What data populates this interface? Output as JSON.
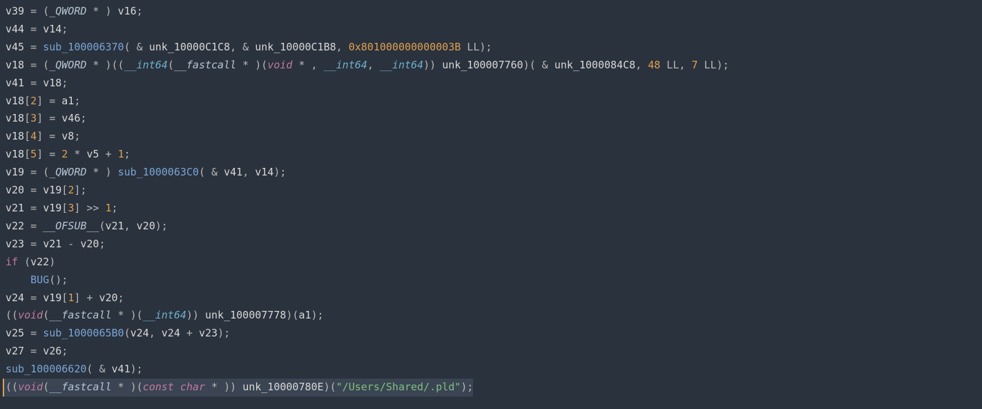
{
  "code": {
    "lines": [
      {
        "tokens": [
          {
            "t": "v39",
            "c": "tk-var"
          },
          {
            "t": " = (",
            "c": "tk-op"
          },
          {
            "t": "_QWORD",
            "c": "tk-type"
          },
          {
            "t": " * ) ",
            "c": "tk-op"
          },
          {
            "t": "v16",
            "c": "tk-var"
          },
          {
            "t": ";",
            "c": "tk-op"
          }
        ]
      },
      {
        "tokens": [
          {
            "t": "v44",
            "c": "tk-var"
          },
          {
            "t": " = ",
            "c": "tk-op"
          },
          {
            "t": "v14",
            "c": "tk-var"
          },
          {
            "t": ";",
            "c": "tk-op"
          }
        ]
      },
      {
        "tokens": [
          {
            "t": "v45",
            "c": "tk-var"
          },
          {
            "t": " = ",
            "c": "tk-op"
          },
          {
            "t": "sub_100006370",
            "c": "tk-sub"
          },
          {
            "t": "( & ",
            "c": "tk-op"
          },
          {
            "t": "unk_10000C1C8",
            "c": "tk-unk"
          },
          {
            "t": ", & ",
            "c": "tk-op"
          },
          {
            "t": "unk_10000C1B8",
            "c": "tk-unk"
          },
          {
            "t": ", ",
            "c": "tk-op"
          },
          {
            "t": "0x801000000000003B",
            "c": "tk-hex"
          },
          {
            "t": " LL);",
            "c": "tk-op"
          }
        ]
      },
      {
        "tokens": [
          {
            "t": "v18",
            "c": "tk-var"
          },
          {
            "t": " = (",
            "c": "tk-op"
          },
          {
            "t": "_QWORD",
            "c": "tk-type"
          },
          {
            "t": " * )((",
            "c": "tk-op"
          },
          {
            "t": "__int64",
            "c": "tk-int64"
          },
          {
            "t": "(",
            "c": "tk-op"
          },
          {
            "t": "__fastcall",
            "c": "tk-type"
          },
          {
            "t": " * )(",
            "c": "tk-op"
          },
          {
            "t": "void",
            "c": "tk-void"
          },
          {
            "t": " * , ",
            "c": "tk-op"
          },
          {
            "t": "__int64",
            "c": "tk-int64"
          },
          {
            "t": ", ",
            "c": "tk-op"
          },
          {
            "t": "__int64",
            "c": "tk-int64"
          },
          {
            "t": ")) ",
            "c": "tk-op"
          },
          {
            "t": "unk_100007760",
            "c": "tk-unk"
          },
          {
            "t": ")( & ",
            "c": "tk-op"
          },
          {
            "t": "unk_1000084C8",
            "c": "tk-unk"
          },
          {
            "t": ", ",
            "c": "tk-op"
          },
          {
            "t": "48",
            "c": "tk-num"
          },
          {
            "t": " LL, ",
            "c": "tk-op"
          },
          {
            "t": "7",
            "c": "tk-num"
          },
          {
            "t": " LL);",
            "c": "tk-op"
          }
        ]
      },
      {
        "tokens": [
          {
            "t": "v41",
            "c": "tk-var"
          },
          {
            "t": " = ",
            "c": "tk-op"
          },
          {
            "t": "v18",
            "c": "tk-var"
          },
          {
            "t": ";",
            "c": "tk-op"
          }
        ]
      },
      {
        "tokens": [
          {
            "t": "v18",
            "c": "tk-var"
          },
          {
            "t": "[",
            "c": "tk-op"
          },
          {
            "t": "2",
            "c": "tk-num"
          },
          {
            "t": "] = ",
            "c": "tk-op"
          },
          {
            "t": "a1",
            "c": "tk-var"
          },
          {
            "t": ";",
            "c": "tk-op"
          }
        ]
      },
      {
        "tokens": [
          {
            "t": "v18",
            "c": "tk-var"
          },
          {
            "t": "[",
            "c": "tk-op"
          },
          {
            "t": "3",
            "c": "tk-num"
          },
          {
            "t": "] = ",
            "c": "tk-op"
          },
          {
            "t": "v46",
            "c": "tk-var"
          },
          {
            "t": ";",
            "c": "tk-op"
          }
        ]
      },
      {
        "tokens": [
          {
            "t": "v18",
            "c": "tk-var"
          },
          {
            "t": "[",
            "c": "tk-op"
          },
          {
            "t": "4",
            "c": "tk-num"
          },
          {
            "t": "] = ",
            "c": "tk-op"
          },
          {
            "t": "v8",
            "c": "tk-var"
          },
          {
            "t": ";",
            "c": "tk-op"
          }
        ]
      },
      {
        "tokens": [
          {
            "t": "v18",
            "c": "tk-var"
          },
          {
            "t": "[",
            "c": "tk-op"
          },
          {
            "t": "5",
            "c": "tk-num"
          },
          {
            "t": "] = ",
            "c": "tk-op"
          },
          {
            "t": "2",
            "c": "tk-num"
          },
          {
            "t": " * ",
            "c": "tk-op"
          },
          {
            "t": "v5",
            "c": "tk-var"
          },
          {
            "t": " + ",
            "c": "tk-op"
          },
          {
            "t": "1",
            "c": "tk-num"
          },
          {
            "t": ";",
            "c": "tk-op"
          }
        ]
      },
      {
        "tokens": [
          {
            "t": "v19",
            "c": "tk-var"
          },
          {
            "t": " = (",
            "c": "tk-op"
          },
          {
            "t": "_QWORD",
            "c": "tk-type"
          },
          {
            "t": " * ) ",
            "c": "tk-op"
          },
          {
            "t": "sub_1000063C0",
            "c": "tk-sub"
          },
          {
            "t": "( & ",
            "c": "tk-op"
          },
          {
            "t": "v41",
            "c": "tk-var"
          },
          {
            "t": ", ",
            "c": "tk-op"
          },
          {
            "t": "v14",
            "c": "tk-var"
          },
          {
            "t": ");",
            "c": "tk-op"
          }
        ]
      },
      {
        "tokens": [
          {
            "t": "v20",
            "c": "tk-var"
          },
          {
            "t": " = ",
            "c": "tk-op"
          },
          {
            "t": "v19",
            "c": "tk-var"
          },
          {
            "t": "[",
            "c": "tk-op"
          },
          {
            "t": "2",
            "c": "tk-num"
          },
          {
            "t": "];",
            "c": "tk-op"
          }
        ]
      },
      {
        "tokens": [
          {
            "t": "v21",
            "c": "tk-var"
          },
          {
            "t": " = ",
            "c": "tk-op"
          },
          {
            "t": "v19",
            "c": "tk-var"
          },
          {
            "t": "[",
            "c": "tk-op"
          },
          {
            "t": "3",
            "c": "tk-num"
          },
          {
            "t": "] >> ",
            "c": "tk-op"
          },
          {
            "t": "1",
            "c": "tk-num"
          },
          {
            "t": ";",
            "c": "tk-op"
          }
        ]
      },
      {
        "tokens": [
          {
            "t": "v22",
            "c": "tk-var"
          },
          {
            "t": " = ",
            "c": "tk-op"
          },
          {
            "t": "__OFSUB__",
            "c": "tk-type"
          },
          {
            "t": "(",
            "c": "tk-op"
          },
          {
            "t": "v21",
            "c": "tk-var"
          },
          {
            "t": ", ",
            "c": "tk-op"
          },
          {
            "t": "v20",
            "c": "tk-var"
          },
          {
            "t": ");",
            "c": "tk-op"
          }
        ]
      },
      {
        "tokens": [
          {
            "t": "v23",
            "c": "tk-var"
          },
          {
            "t": " = ",
            "c": "tk-op"
          },
          {
            "t": "v21",
            "c": "tk-var"
          },
          {
            "t": " - ",
            "c": "tk-op"
          },
          {
            "t": "v20",
            "c": "tk-var"
          },
          {
            "t": ";",
            "c": "tk-op"
          }
        ]
      },
      {
        "tokens": [
          {
            "t": "if",
            "c": "tk-kw"
          },
          {
            "t": " (",
            "c": "tk-op"
          },
          {
            "t": "v22",
            "c": "tk-var"
          },
          {
            "t": ")",
            "c": "tk-op"
          }
        ]
      },
      {
        "tokens": [
          {
            "t": "    ",
            "c": "tk-op"
          },
          {
            "t": "BUG",
            "c": "tk-sub"
          },
          {
            "t": "();",
            "c": "tk-op"
          }
        ]
      },
      {
        "tokens": [
          {
            "t": "v24",
            "c": "tk-var"
          },
          {
            "t": " = ",
            "c": "tk-op"
          },
          {
            "t": "v19",
            "c": "tk-var"
          },
          {
            "t": "[",
            "c": "tk-op"
          },
          {
            "t": "1",
            "c": "tk-num"
          },
          {
            "t": "] + ",
            "c": "tk-op"
          },
          {
            "t": "v20",
            "c": "tk-var"
          },
          {
            "t": ";",
            "c": "tk-op"
          }
        ]
      },
      {
        "tokens": [
          {
            "t": "((",
            "c": "tk-op"
          },
          {
            "t": "void",
            "c": "tk-void"
          },
          {
            "t": "(",
            "c": "tk-op"
          },
          {
            "t": "__fastcall",
            "c": "tk-type"
          },
          {
            "t": " * )(",
            "c": "tk-op"
          },
          {
            "t": "__int64",
            "c": "tk-int64"
          },
          {
            "t": ")) ",
            "c": "tk-op"
          },
          {
            "t": "unk_100007778",
            "c": "tk-unk"
          },
          {
            "t": ")(",
            "c": "tk-op"
          },
          {
            "t": "a1",
            "c": "tk-var"
          },
          {
            "t": ");",
            "c": "tk-op"
          }
        ]
      },
      {
        "tokens": [
          {
            "t": "v25",
            "c": "tk-var"
          },
          {
            "t": " = ",
            "c": "tk-op"
          },
          {
            "t": "sub_1000065B0",
            "c": "tk-sub"
          },
          {
            "t": "(",
            "c": "tk-op"
          },
          {
            "t": "v24",
            "c": "tk-var"
          },
          {
            "t": ", ",
            "c": "tk-op"
          },
          {
            "t": "v24",
            "c": "tk-var"
          },
          {
            "t": " + ",
            "c": "tk-op"
          },
          {
            "t": "v23",
            "c": "tk-var"
          },
          {
            "t": ");",
            "c": "tk-op"
          }
        ]
      },
      {
        "tokens": [
          {
            "t": "v27",
            "c": "tk-var"
          },
          {
            "t": " = ",
            "c": "tk-op"
          },
          {
            "t": "v26",
            "c": "tk-var"
          },
          {
            "t": ";",
            "c": "tk-op"
          }
        ]
      },
      {
        "tokens": [
          {
            "t": "sub_100006620",
            "c": "tk-sub"
          },
          {
            "t": "( & ",
            "c": "tk-op"
          },
          {
            "t": "v41",
            "c": "tk-var"
          },
          {
            "t": ");",
            "c": "tk-op"
          }
        ]
      },
      {
        "highlighted": true,
        "tokens": [
          {
            "t": "((",
            "c": "tk-op"
          },
          {
            "t": "void",
            "c": "tk-void"
          },
          {
            "t": "(",
            "c": "tk-op"
          },
          {
            "t": "__fastcall",
            "c": "tk-type"
          },
          {
            "t": " * )(",
            "c": "tk-op"
          },
          {
            "t": "const",
            "c": "tk-const"
          },
          {
            "t": " ",
            "c": "tk-op"
          },
          {
            "t": "char",
            "c": "tk-char"
          },
          {
            "t": " * )) ",
            "c": "tk-op"
          },
          {
            "t": "unk_10000780E",
            "c": "tk-unk"
          },
          {
            "t": ")(",
            "c": "tk-op"
          },
          {
            "t": "\"/Users/Shared/.pld\"",
            "c": "tk-str"
          },
          {
            "t": ");",
            "c": "tk-op"
          }
        ]
      }
    ]
  }
}
